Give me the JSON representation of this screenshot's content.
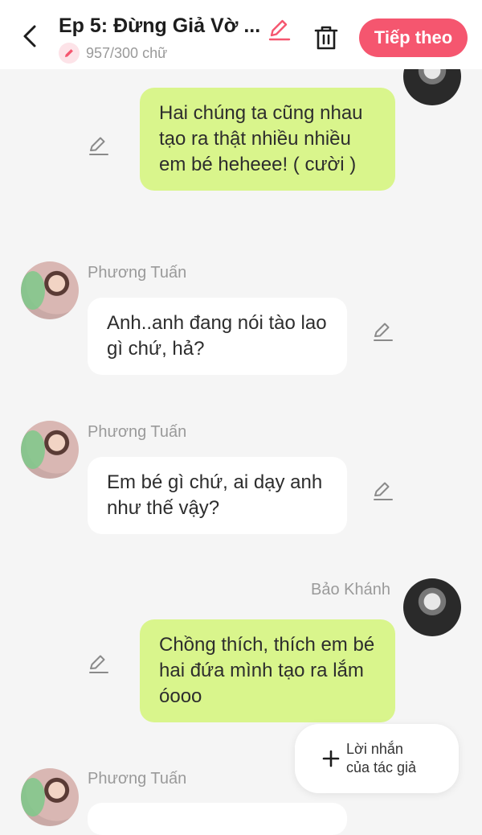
{
  "header": {
    "title": "Ep 5: Đừng Giả Vờ ...",
    "word_count": "957/300 chữ",
    "next_label": "Tiếp theo",
    "accent_color": "#f5566f"
  },
  "icons": {
    "back": "chevron-left-icon",
    "edit_title": "pencil-icon",
    "delete": "trash-icon",
    "edit_message": "pencil-icon",
    "add": "plus-icon"
  },
  "messages": [
    {
      "side": "right",
      "sender": "",
      "text": "Hai chúng ta cũng nhau tạo ra thật nhiều nhiều em bé heheee! ( cười )",
      "color": "#d9f58c"
    },
    {
      "side": "left",
      "sender": "Phương Tuấn",
      "text": "Anh..anh đang nói tào lao gì chứ, hả?",
      "color": "#ffffff"
    },
    {
      "side": "left",
      "sender": "Phương Tuấn",
      "text": "Em bé gì chứ, ai dạy anh như thế vậy?",
      "color": "#ffffff"
    },
    {
      "side": "right",
      "sender": "Bảo Khánh",
      "text": "Chồng thích, thích em bé hai đứa mình tạo ra lắm óooo",
      "color": "#d9f58c"
    },
    {
      "side": "left",
      "sender": "Phương Tuấn",
      "text": "",
      "color": "#ffffff"
    }
  ],
  "fab": {
    "label_line1": "Lời nhắn",
    "label_line2": "của tác giả"
  }
}
